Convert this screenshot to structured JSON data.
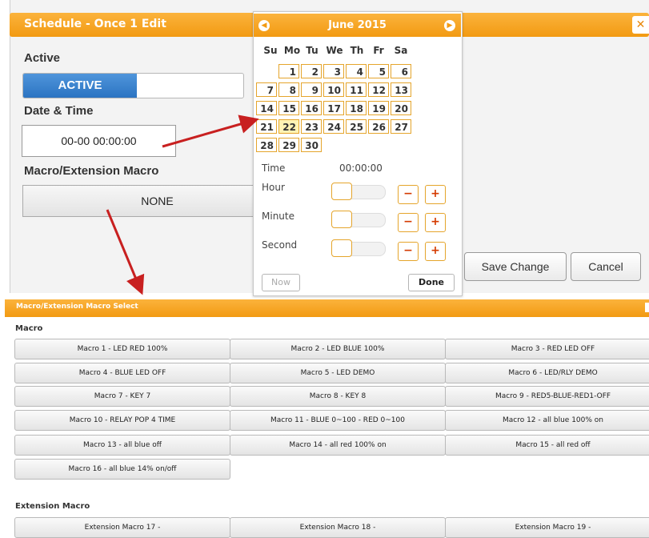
{
  "dialog": {
    "title": "Schedule - Once 1 Edit",
    "close_icon": "x-icon",
    "active_label": "Active",
    "active_value": "ACTIVE",
    "datetime_label": "Date & Time",
    "datetime_value": "00-00 00:00:00",
    "macro_label": "Macro/Extension Macro",
    "macro_value": "NONE",
    "save_label": "Save Change",
    "cancel_label": "Cancel"
  },
  "datepicker": {
    "month": "June 2015",
    "weekdays": [
      "Su",
      "Mo",
      "Tu",
      "We",
      "Th",
      "Fr",
      "Sa"
    ],
    "weeks": [
      [
        "",
        "1",
        "2",
        "3",
        "4",
        "5",
        "6"
      ],
      [
        "7",
        "8",
        "9",
        "10",
        "11",
        "12",
        "13"
      ],
      [
        "14",
        "15",
        "16",
        "17",
        "18",
        "19",
        "20"
      ],
      [
        "21",
        "22",
        "23",
        "24",
        "25",
        "26",
        "27"
      ],
      [
        "28",
        "29",
        "30",
        "",
        "",
        "",
        ""
      ]
    ],
    "selected_day": "22",
    "time_label": "Time",
    "time_value": "00:00:00",
    "hour_label": "Hour",
    "minute_label": "Minute",
    "second_label": "Second",
    "minus": "−",
    "plus": "+",
    "now_label": "Now",
    "done_label": "Done"
  },
  "panel": {
    "title": "Macro/Extension Macro Select",
    "macro_section": "Macro",
    "macros": [
      "Macro 1 - LED RED 100%",
      "Macro 2 - LED BLUE 100%",
      "Macro 3 - RED LED OFF",
      "Macro 4 - BLUE LED OFF",
      "Macro 5 - LED DEMO",
      "Macro 6 - LED/RLY DEMO",
      "Macro 7 - KEY 7",
      "Macro 8 - KEY 8",
      "Macro 9 - RED5-BLUE-RED1-OFF",
      "Macro 10 - RELAY POP 4 TIME",
      "Macro 11 - BLUE 0~100 - RED 0~100",
      "Macro 12 - all blue 100% on",
      "Macro 13 - all blue off",
      "Macro 14 - all red 100% on",
      "Macro 15 - all red off",
      "Macro 16 - all blue 14% on/off"
    ],
    "extension_section": "Extension Macro",
    "extensions": [
      "Extension Macro 17 -",
      "Extension Macro 18 -",
      "Extension Macro 19 -"
    ]
  }
}
